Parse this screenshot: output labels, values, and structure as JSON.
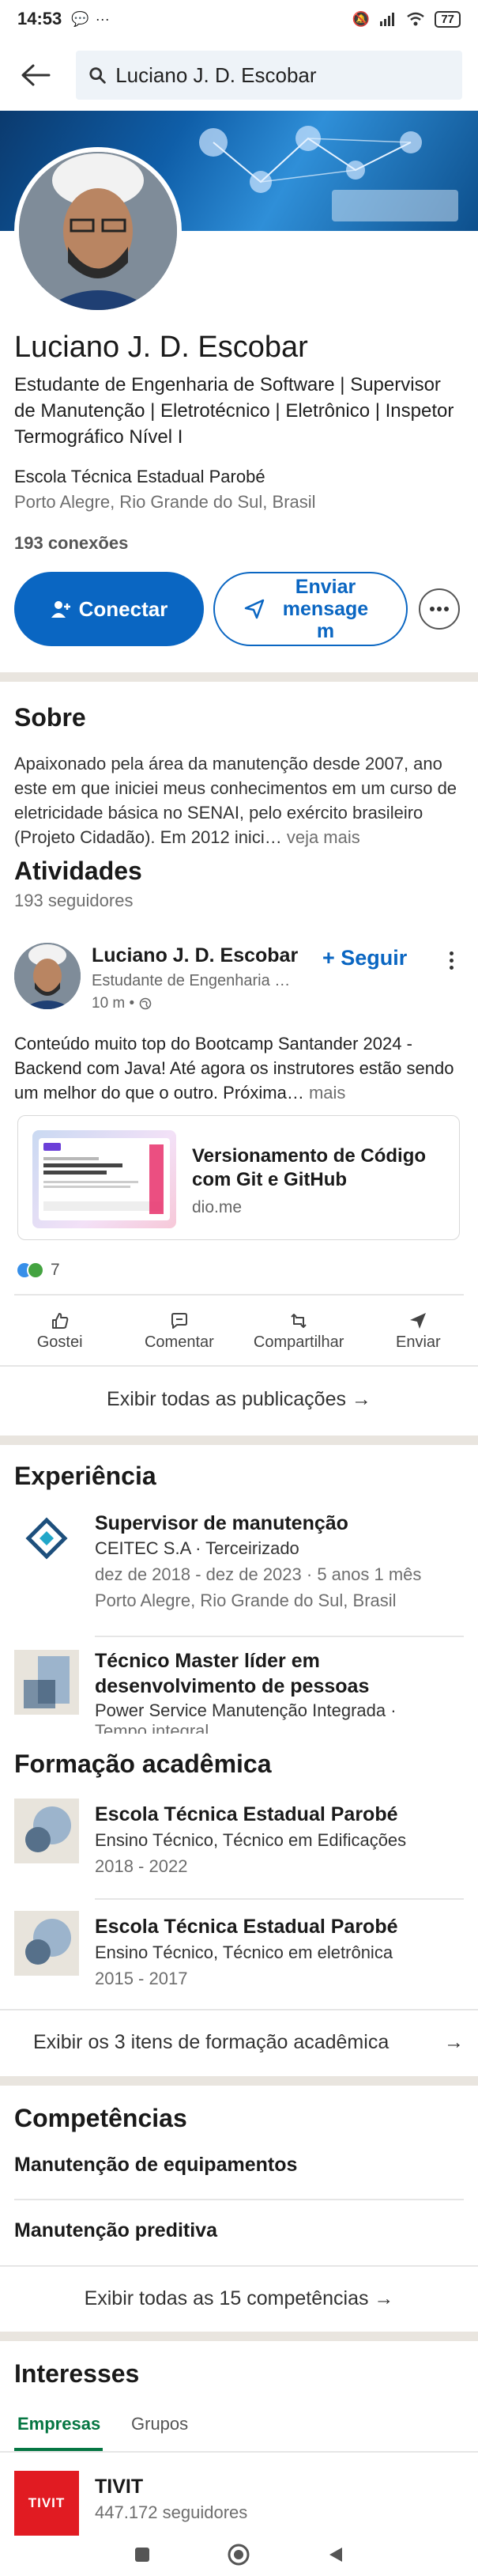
{
  "status_bar": {
    "time": "14:53",
    "battery": "77"
  },
  "search": {
    "value": "Luciano J. D. Escobar"
  },
  "profile": {
    "name": "Luciano J. D. Escobar",
    "headline": "Estudante de Engenharia de Software | Supervisor de Manutenção | Eletrotécnico | Eletrônico | Inspetor Termográfico Nível I",
    "school": "Escola Técnica Estadual Parobé",
    "location": "Porto Alegre, Rio Grande do Sul, Brasil",
    "connections": "193 conexões",
    "connect_label": "Conectar",
    "message_label": "Enviar mensage m"
  },
  "about": {
    "title": "Sobre",
    "text": "Apaixonado pela área da manutenção desde 2007, ano este em que iniciei meus conhecimentos em um curso de eletricidade básica no SENAI, pelo exército brasileiro (Projeto Cidadão). Em 2012 inici…",
    "more": " veja mais"
  },
  "activity": {
    "title": "Atividades",
    "followers": "193 seguidores",
    "post": {
      "author": "Luciano J. D. Escobar",
      "subtitle": "Estudante de Engenharia de Software",
      "time": "10 m •",
      "follow_label": "+ Seguir",
      "text": "Conteúdo muito top do Bootcamp Santander 2024 - Backend com Java! Até agora os instrutores estão sendo um melhor do que o outro. Próxima…",
      "more": " mais",
      "link_title": "Versionamento de Código com Git e GitHub",
      "link_domain": "dio.me",
      "reaction_count": "7",
      "actions": [
        "Gostei",
        "Comentar",
        "Compartilhar",
        "Enviar"
      ]
    },
    "show_all": "Exibir todas as publicações →"
  },
  "experience": {
    "title": "Experiência",
    "items": [
      {
        "title": "Supervisor de manutenção",
        "company": "CEITEC S.A · Terceirizado",
        "dates": "dez de 2018 - dez de 2023 · 5 anos 1 mês",
        "location": "Porto Alegre, Rio Grande do Sul, Brasil"
      },
      {
        "title": "Técnico Master líder em desenvolvimento de pessoas",
        "company": "Power Service Manutenção Integrada ·",
        "dates": "Tempo integral"
      }
    ]
  },
  "education": {
    "title": "Formação acadêmica",
    "items": [
      {
        "school": "Escola Técnica Estadual Parobé",
        "degree": "Ensino Técnico, Técnico em Edificações",
        "years": "2018 - 2022"
      },
      {
        "school": "Escola Técnica Estadual Parobé",
        "degree": "Ensino Técnico, Técnico em eletrônica",
        "years": "2015 - 2017"
      }
    ],
    "show_all": "Exibir os 3 itens de formação acadêmica",
    "arrow": "→"
  },
  "skills": {
    "title": "Competências",
    "items": [
      "Manutenção de equipamentos",
      "Manutenção preditiva"
    ],
    "show_all": "Exibir todas as 15 competências →"
  },
  "interests": {
    "title": "Interesses",
    "tabs": [
      "Empresas",
      "Grupos"
    ],
    "company": {
      "logo_text": "TIVIT",
      "name": "TIVIT",
      "followers": "447.172 seguidores"
    }
  },
  "colors": {
    "primary": "#0a66c2",
    "green": "#057642",
    "divider": "#e9e5df"
  }
}
